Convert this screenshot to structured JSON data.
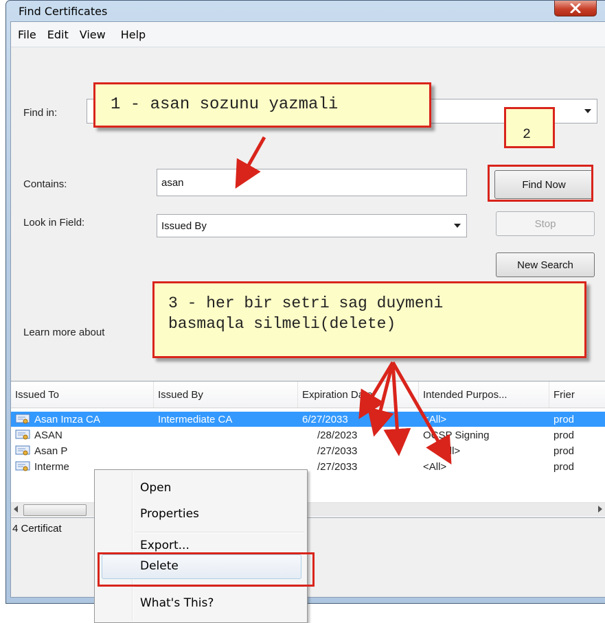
{
  "window": {
    "title": "Find Certificates"
  },
  "menubar": [
    "File",
    "Edit",
    "View",
    "Help"
  ],
  "form": {
    "find_in_label": "Find in:",
    "contains_label": "Contains:",
    "contains_value": "asan",
    "look_in_field_label": "Look in Field:",
    "look_in_field_value": "Issued By",
    "learn_more_label": "Learn more about"
  },
  "buttons": {
    "find_now": "Find Now",
    "stop": "Stop",
    "new_search": "New Search"
  },
  "annotations": {
    "note1": "1 - asan sozunu yazmali",
    "note2": "2",
    "note3_line1": "3 - her bir setri sag duymeni",
    "note3_line2": "basmaqla silmeli(delete)"
  },
  "list": {
    "columns": [
      "Issued To",
      "Issued By",
      "Expiration Date",
      "Intended Purpos...",
      "Frier"
    ],
    "rows": [
      {
        "issued_to": "Asan Imza CA",
        "issued_by": "Intermediate CA",
        "expiration": "6/27/2033",
        "purpose": "<All>",
        "friendly": "prod",
        "selected": true
      },
      {
        "issued_to": "ASAN",
        "issued_by": "",
        "expiration": "/28/2023",
        "purpose": "OCSP Signing",
        "friendly": "prod",
        "selected": false
      },
      {
        "issued_to": "Asan P",
        "issued_by": "",
        "expiration": "/27/2033",
        "purpose": "<All>",
        "friendly": "prod",
        "selected": false
      },
      {
        "issued_to": "Interme",
        "issued_by": "",
        "expiration": "/27/2033",
        "purpose": "<All>",
        "friendly": "prod",
        "selected": false
      }
    ]
  },
  "status": "4 Certificat",
  "context_menu": {
    "open": "Open",
    "properties": "Properties",
    "export": "Export...",
    "delete": "Delete",
    "whats_this": "What's This?"
  },
  "colors": {
    "selection": "#3399ff",
    "annotation_red": "#d9241b",
    "note_bg": "#fdfdc8"
  }
}
